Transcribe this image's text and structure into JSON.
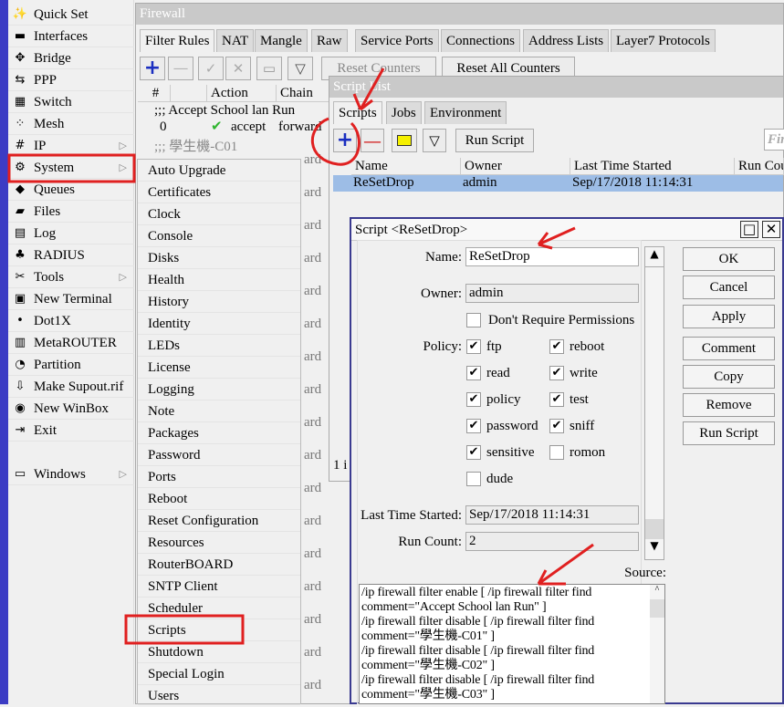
{
  "sidebar": {
    "items": [
      {
        "label": "Quick Set",
        "icon": "wand-icon"
      },
      {
        "label": "Interfaces",
        "icon": "interfaces-icon"
      },
      {
        "label": "Bridge",
        "icon": "bridge-icon"
      },
      {
        "label": "PPP",
        "icon": "ppp-icon"
      },
      {
        "label": "Switch",
        "icon": "switch-icon"
      },
      {
        "label": "Mesh",
        "icon": "mesh-icon"
      },
      {
        "label": "IP",
        "icon": "ip-icon",
        "submenu": true
      },
      {
        "label": "System",
        "icon": "gear-icon",
        "submenu": true
      },
      {
        "label": "Queues",
        "icon": "queues-icon"
      },
      {
        "label": "Files",
        "icon": "folder-icon"
      },
      {
        "label": "Log",
        "icon": "log-icon"
      },
      {
        "label": "RADIUS",
        "icon": "radius-icon"
      },
      {
        "label": "Tools",
        "icon": "tools-icon",
        "submenu": true
      },
      {
        "label": "New Terminal",
        "icon": "terminal-icon"
      },
      {
        "label": "Dot1X",
        "icon": "dot1x-icon"
      },
      {
        "label": "MetaROUTER",
        "icon": "metarouter-icon"
      },
      {
        "label": "Partition",
        "icon": "partition-icon"
      },
      {
        "label": "Make Supout.rif",
        "icon": "supout-icon"
      },
      {
        "label": "New WinBox",
        "icon": "winbox-icon"
      },
      {
        "label": "Exit",
        "icon": "exit-icon"
      },
      {
        "label": "Windows",
        "icon": "windows-icon",
        "submenu": true
      }
    ]
  },
  "system_menu": [
    "Auto Upgrade",
    "Certificates",
    "Clock",
    "Console",
    "Disks",
    "Health",
    "History",
    "Identity",
    "LEDs",
    "License",
    "Logging",
    "Note",
    "Packages",
    "Password",
    "Ports",
    "Reboot",
    "Reset Configuration",
    "Resources",
    "RouterBOARD",
    "SNTP Client",
    "Scheduler",
    "Scripts",
    "Shutdown",
    "Special Login",
    "Users"
  ],
  "firewall": {
    "title": "Firewall",
    "tabs": [
      "Filter Rules",
      "NAT",
      "Mangle",
      "Raw",
      "Service Ports",
      "Connections",
      "Address Lists",
      "Layer7 Protocols"
    ],
    "reset_counters": "Reset Counters",
    "reset_all_counters": "Reset All Counters",
    "columns": [
      "#",
      "Action",
      "Chain"
    ],
    "comment1": ";;; Accept School lan Run",
    "row0": {
      "num": "0",
      "action": "accept",
      "chain": "forward"
    },
    "comment2": ";;; 學生機-C01",
    "chain_partial": "ard"
  },
  "script_list": {
    "title": "Script List",
    "tabs": [
      "Scripts",
      "Jobs",
      "Environment"
    ],
    "run_script": "Run Script",
    "find_placeholder": "Find",
    "columns": [
      "Name",
      "Owner",
      "Last Time Started",
      "Run Cou"
    ],
    "rows": [
      {
        "name": "ReSetDrop",
        "owner": "admin",
        "last": "Sep/17/2018 11:14:31"
      }
    ],
    "status": "1 i"
  },
  "dialog": {
    "title": "Script <ReSetDrop>",
    "name_label": "Name:",
    "name": "ReSetDrop",
    "owner_label": "Owner:",
    "owner": "admin",
    "dont_require": "Don't Require Permissions",
    "policy_label": "Policy:",
    "policies": [
      {
        "label": "ftp",
        "checked": true
      },
      {
        "label": "reboot",
        "checked": true
      },
      {
        "label": "read",
        "checked": true
      },
      {
        "label": "write",
        "checked": true
      },
      {
        "label": "policy",
        "checked": true
      },
      {
        "label": "test",
        "checked": true
      },
      {
        "label": "password",
        "checked": true
      },
      {
        "label": "sniff",
        "checked": true
      },
      {
        "label": "sensitive",
        "checked": true
      },
      {
        "label": "romon",
        "checked": false
      },
      {
        "label": "dude",
        "checked": false
      }
    ],
    "last_label": "Last Time Started:",
    "last": "Sep/17/2018 11:14:31",
    "count_label": "Run Count:",
    "count": "2",
    "source_label": "Source:",
    "source": [
      "/ip firewall filter enable [ /ip firewall filter find",
      "comment=\"Accept School lan Run\" ]",
      "/ip firewall filter disable [ /ip firewall filter find",
      "comment=\"學生機-C01\" ]",
      "/ip firewall filter disable [ /ip firewall filter find",
      "comment=\"學生機-C02\" ]",
      "/ip firewall filter disable [ /ip firewall filter find",
      "comment=\"學生機-C03\" ]"
    ],
    "buttons": [
      "OK",
      "Cancel",
      "Apply",
      "Comment",
      "Copy",
      "Remove",
      "Run Script"
    ]
  },
  "colors": {
    "annotation": "#e02020",
    "selection": "#9dbde6",
    "accent_strip": "#3c3cc4"
  }
}
